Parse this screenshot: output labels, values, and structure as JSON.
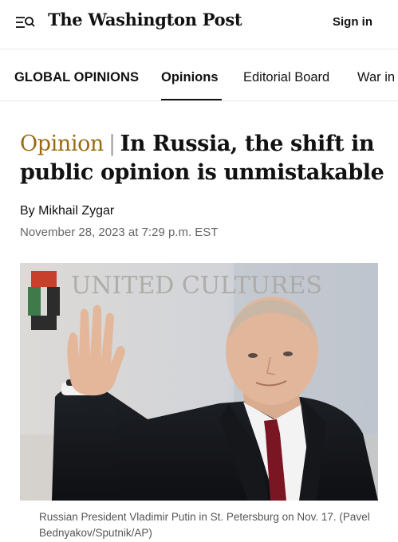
{
  "header": {
    "logo": "The Washington Post",
    "signin_label": "Sign in",
    "menu_icon": "menu-search-icon"
  },
  "section_nav": {
    "section_title": "GLOBAL OPINIONS",
    "tabs": [
      {
        "label": "Opinions",
        "active": true
      },
      {
        "label": "Editorial Board",
        "active": false
      },
      {
        "label": "War in",
        "active": false
      }
    ]
  },
  "article": {
    "kicker": "Opinion",
    "separator": "|",
    "title": "In Russia, the shift in public opinion is unmistakable",
    "byline": "By Mikhail Zygar",
    "timestamp": "November 28, 2023 at 7:29 p.m. EST",
    "photo": {
      "backdrop_text": "UNITED CULTURES",
      "caption": "Russian President Vladimir Putin in St. Petersburg on Nov. 17. (Pavel Bednyakov/Sputnik/AP)"
    }
  },
  "colors": {
    "kicker": "#9a6a13",
    "text": "#111111",
    "muted": "#666666",
    "tie": "#7a1522"
  }
}
